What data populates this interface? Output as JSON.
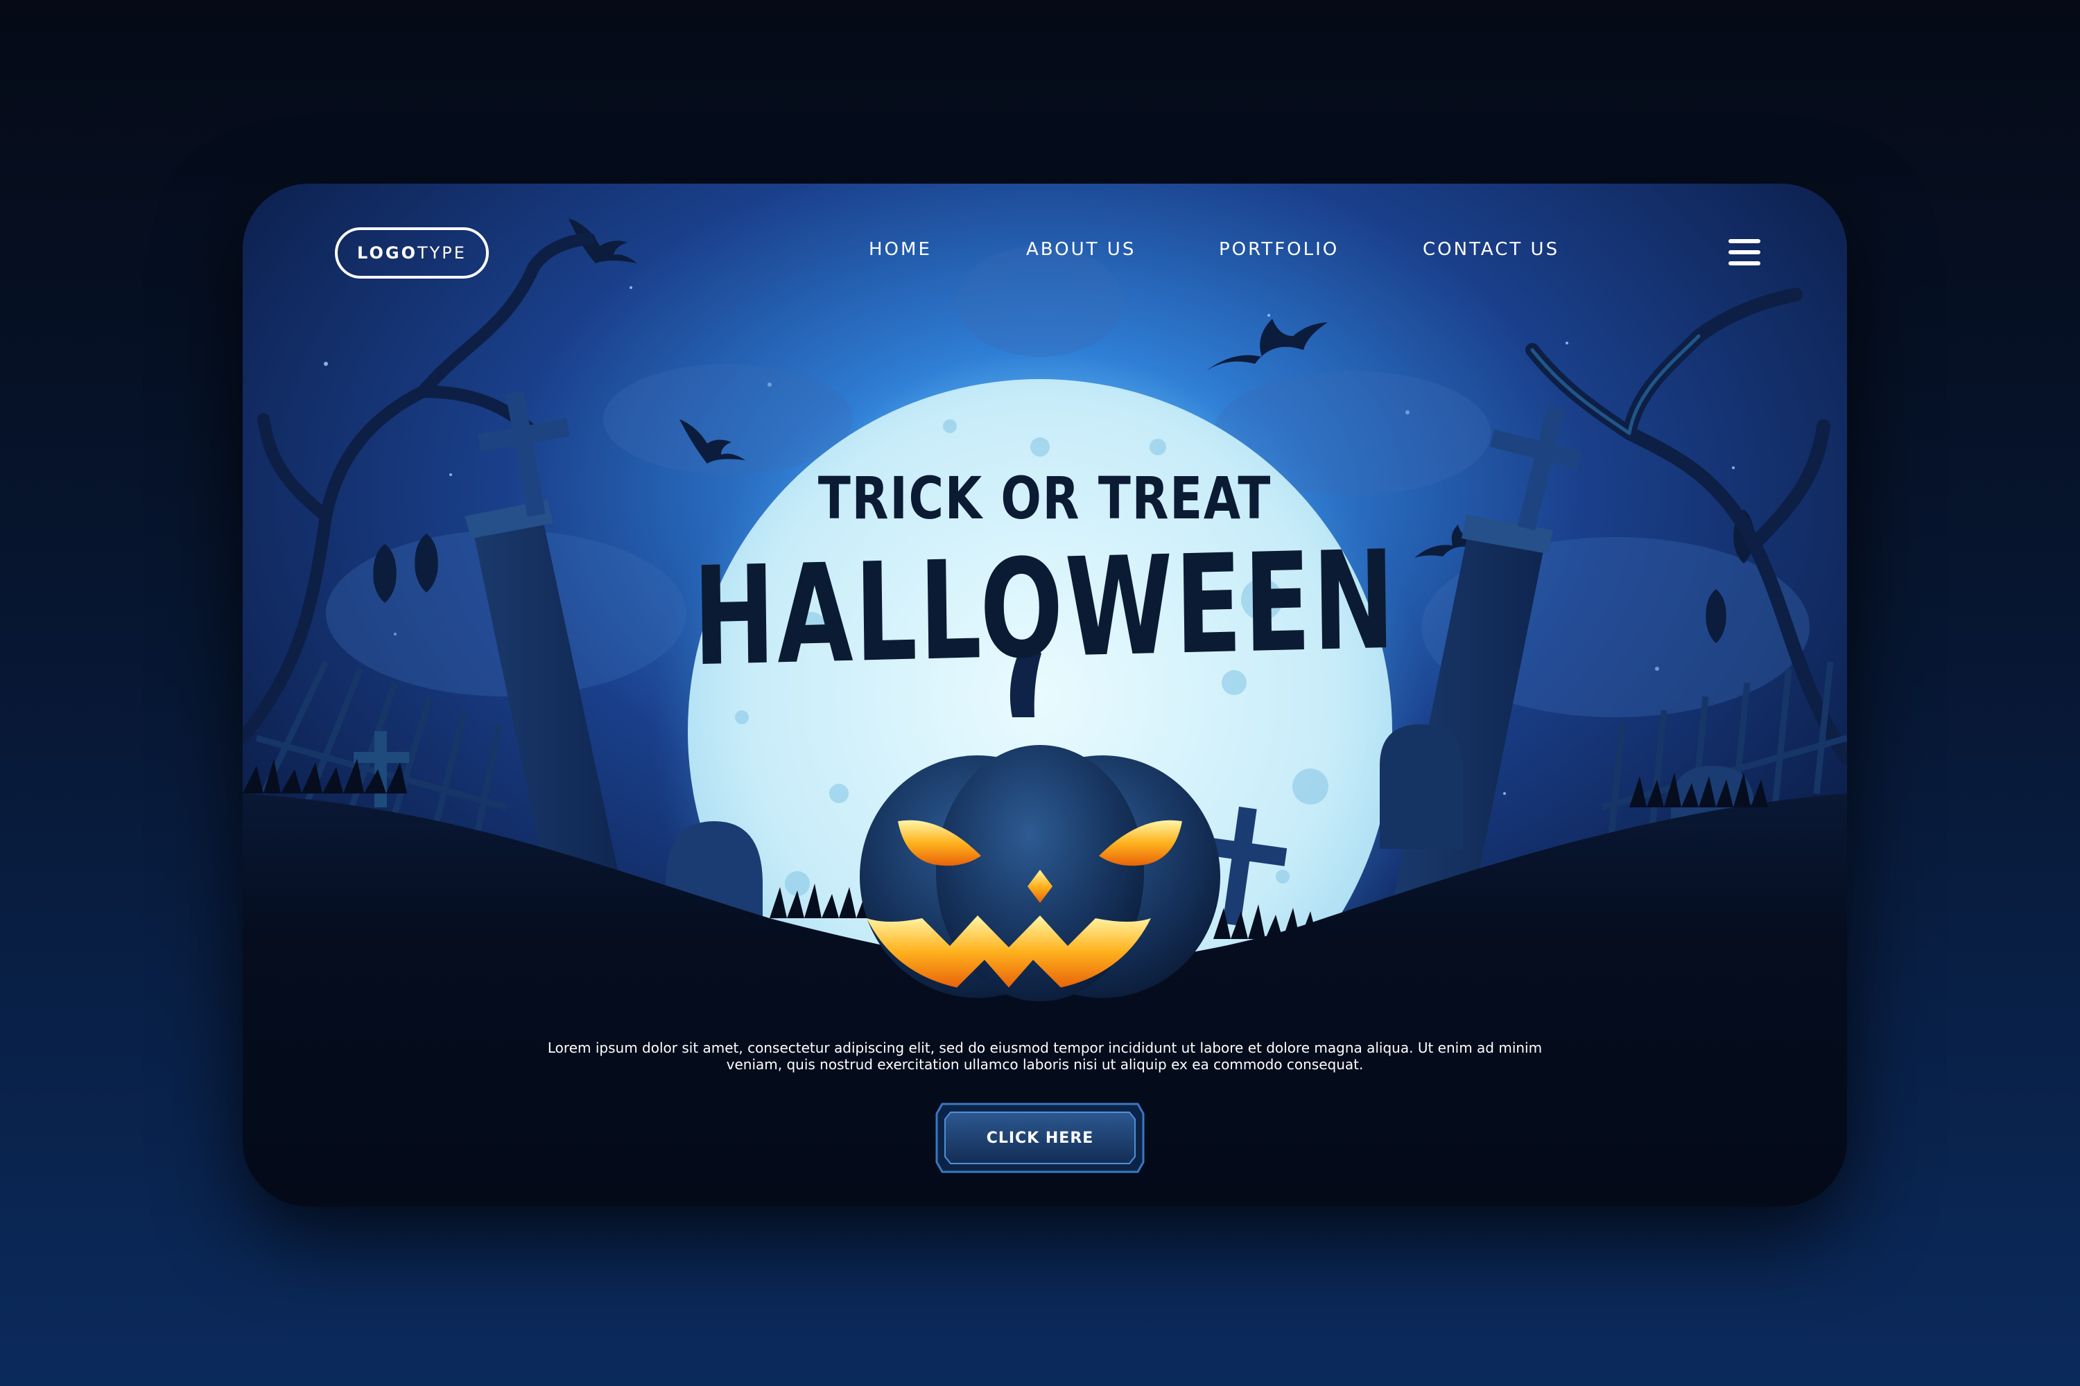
{
  "logo": {
    "bold": "LOGO",
    "light": "TYPE"
  },
  "nav": {
    "items": [
      {
        "label": "HOME"
      },
      {
        "label": "ABOUT US"
      },
      {
        "label": "PORTFOLIO"
      },
      {
        "label": "CONTACT US"
      }
    ],
    "menu_icon": "hamburger-menu-icon"
  },
  "hero": {
    "subtitle": "TRICK OR TREAT",
    "title": "HALLOWEEN",
    "body_line1": "Lorem ipsum dolor sit amet, consectetur adipiscing elit, sed do eiusmod tempor incididunt ut labore et dolore magna aliqua. Ut enim ad minim",
    "body_line2": "veniam, quis nostrud exercitation ullamco laboris nisi ut aliquip ex ea commodo consequat.",
    "button_label": "CLICK HERE"
  },
  "colors": {
    "background_top": "#050a16",
    "background_bottom": "#0b2a5c",
    "moon": "#cdeefa",
    "sky": "#1b4a9a",
    "ground": "#050d1f",
    "title_text": "#0a1b33",
    "pumpkin": "#16335d",
    "pumpkin_glow": "#ffb21e",
    "button": "#1d3f6e"
  },
  "icons": [
    "hamburger-menu-icon",
    "bat-icon",
    "cross-icon",
    "tombstone-icon",
    "jack-o-lantern-icon",
    "moon-icon",
    "dead-tree-icon"
  ]
}
